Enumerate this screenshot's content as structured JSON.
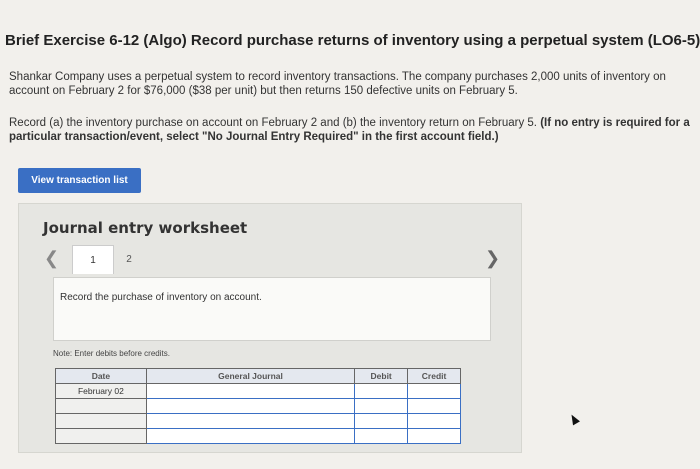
{
  "header": {
    "title": "Brief Exercise 6-12 (Algo) Record purchase returns of inventory using a perpetual system (LO6-5)"
  },
  "problem": {
    "para1": "Shankar Company uses a perpetual system to record inventory transactions. The company purchases 2,000 units of inventory on account on February 2 for $76,000 ($38 per unit) but then returns 150 defective units on February 5.",
    "para2_plain": "Record (a) the inventory purchase on account on February 2 and (b) the inventory return on February 5. ",
    "para2_bold": "(If no entry is required for a particular transaction/event, select \"No Journal Entry Required\" in the first account field.)"
  },
  "buttons": {
    "view_transactions": "View transaction list"
  },
  "worksheet": {
    "title": "Journal entry worksheet",
    "tabs": [
      "1",
      "2"
    ],
    "active_tab": "1",
    "description": "Record the purchase of inventory on account.",
    "note": "Note: Enter debits before credits.",
    "columns": [
      "Date",
      "General Journal",
      "Debit",
      "Credit"
    ],
    "first_date": "February 02",
    "row_count": 4
  }
}
